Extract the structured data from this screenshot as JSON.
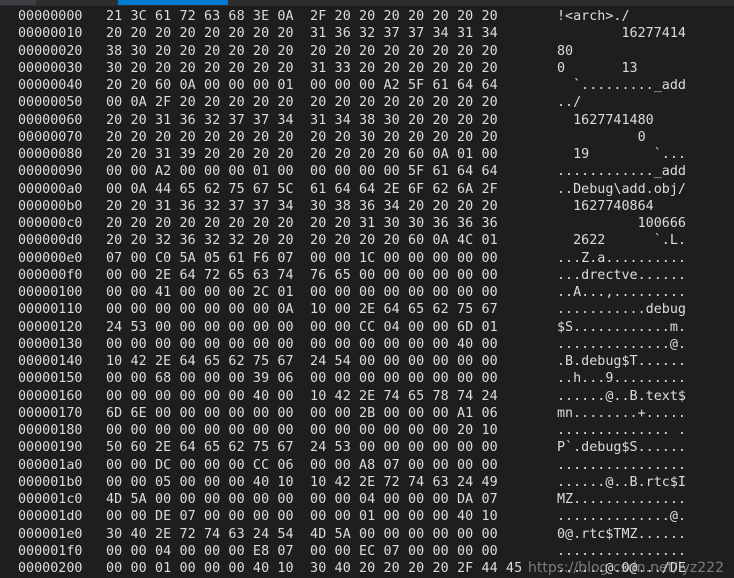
{
  "rows": [
    {
      "addr": "00000000",
      "hex": "21 3C 61 72 63 68 3E 0A  2F 20 20 20 20 20 20 20",
      "ascii": "!<arch>./"
    },
    {
      "addr": "00000010",
      "hex": "20 20 20 20 20 20 20 20  31 36 32 37 37 34 31 34",
      "ascii": "        16277414"
    },
    {
      "addr": "00000020",
      "hex": "38 30 20 20 20 20 20 20  20 20 20 20 20 20 20 20",
      "ascii": "80"
    },
    {
      "addr": "00000030",
      "hex": "30 20 20 20 20 20 20 20  31 33 20 20 20 20 20 20",
      "ascii": "0       13"
    },
    {
      "addr": "00000040",
      "hex": "20 20 60 0A 00 00 00 01  00 00 00 A2 5F 61 64 64",
      "ascii": "  `........._add"
    },
    {
      "addr": "00000050",
      "hex": "00 0A 2F 20 20 20 20 20  20 20 20 20 20 20 20 20",
      "ascii": "../"
    },
    {
      "addr": "00000060",
      "hex": "20 20 31 36 32 37 37 34  31 34 38 30 20 20 20 20",
      "ascii": "  1627741480"
    },
    {
      "addr": "00000070",
      "hex": "20 20 20 20 20 20 20 20  20 20 30 20 20 20 20 20",
      "ascii": "          0"
    },
    {
      "addr": "00000080",
      "hex": "20 20 31 39 20 20 20 20  20 20 20 20 60 0A 01 00",
      "ascii": "  19        `..."
    },
    {
      "addr": "00000090",
      "hex": "00 00 A2 00 00 00 01 00  00 00 00 00 5F 61 64 64",
      "ascii": "............_add"
    },
    {
      "addr": "000000a0",
      "hex": "00 0A 44 65 62 75 67 5C  61 64 64 2E 6F 62 6A 2F",
      "ascii": "..Debug\\add.obj/"
    },
    {
      "addr": "000000b0",
      "hex": "20 20 31 36 32 37 37 34  30 38 36 34 20 20 20 20",
      "ascii": "  1627740864"
    },
    {
      "addr": "000000c0",
      "hex": "20 20 20 20 20 20 20 20  20 20 31 30 30 36 36 36",
      "ascii": "          100666"
    },
    {
      "addr": "000000d0",
      "hex": "20 20 32 36 32 32 20 20  20 20 20 20 60 0A 4C 01",
      "ascii": "  2622      `.L."
    },
    {
      "addr": "000000e0",
      "hex": "07 00 C0 5A 05 61 F6 07  00 00 1C 00 00 00 00 00",
      "ascii": "...Z.a.........."
    },
    {
      "addr": "000000f0",
      "hex": "00 00 2E 64 72 65 63 74  76 65 00 00 00 00 00 00",
      "ascii": "...drectve......"
    },
    {
      "addr": "00000100",
      "hex": "00 00 41 00 00 00 2C 01  00 00 00 00 00 00 00 00",
      "ascii": "..A...,........."
    },
    {
      "addr": "00000110",
      "hex": "00 00 00 00 00 00 00 0A  10 00 2E 64 65 62 75 67",
      "ascii": "...........debug"
    },
    {
      "addr": "00000120",
      "hex": "24 53 00 00 00 00 00 00  00 00 CC 04 00 00 6D 01",
      "ascii": "$S............m."
    },
    {
      "addr": "00000130",
      "hex": "00 00 00 00 00 00 00 00  00 00 00 00 00 00 40 00",
      "ascii": "..............@."
    },
    {
      "addr": "00000140",
      "hex": "10 42 2E 64 65 62 75 67  24 54 00 00 00 00 00 00",
      "ascii": ".B.debug$T......"
    },
    {
      "addr": "00000150",
      "hex": "00 00 68 00 00 00 39 06  00 00 00 00 00 00 00 00",
      "ascii": "..h...9........."
    },
    {
      "addr": "00000160",
      "hex": "00 00 00 00 00 00 40 00  10 42 2E 74 65 78 74 24",
      "ascii": "......@..B.text$"
    },
    {
      "addr": "00000170",
      "hex": "6D 6E 00 00 00 00 00 00  00 00 2B 00 00 00 A1 06",
      "ascii": "mn........+....."
    },
    {
      "addr": "00000180",
      "hex": "00 00 00 00 00 00 00 00  00 00 00 00 00 00 20 10",
      "ascii": ".............. ."
    },
    {
      "addr": "00000190",
      "hex": "50 60 2E 64 65 62 75 67  24 53 00 00 00 00 00 00",
      "ascii": "P`.debug$S......"
    },
    {
      "addr": "000001a0",
      "hex": "00 00 DC 00 00 00 CC 06  00 00 A8 07 00 00 00 00",
      "ascii": "................"
    },
    {
      "addr": "000001b0",
      "hex": "00 00 05 00 00 00 40 10  10 42 2E 72 74 63 24 49",
      "ascii": "......@..B.rtc$I"
    },
    {
      "addr": "000001c0",
      "hex": "4D 5A 00 00 00 00 00 00  00 00 04 00 00 00 DA 07",
      "ascii": "MZ.............."
    },
    {
      "addr": "000001d0",
      "hex": "00 00 DE 07 00 00 00 00  00 00 01 00 00 00 40 10",
      "ascii": "..............@."
    },
    {
      "addr": "000001e0",
      "hex": "30 40 2E 72 74 63 24 54  4D 5A 00 00 00 00 00 00",
      "ascii": "0@.rtc$TMZ......"
    },
    {
      "addr": "000001f0",
      "hex": "00 00 04 00 00 00 E8 07  00 00 EC 07 00 00 00 00",
      "ascii": "................"
    },
    {
      "addr": "00000200",
      "hex": "00 00 01 00 00 00 40 10  30 40 20 20 20 20 2F 44 45",
      "ascii": "......@.0@.../DE"
    }
  ],
  "watermark": "https://blog.csdn.net/lyz222"
}
